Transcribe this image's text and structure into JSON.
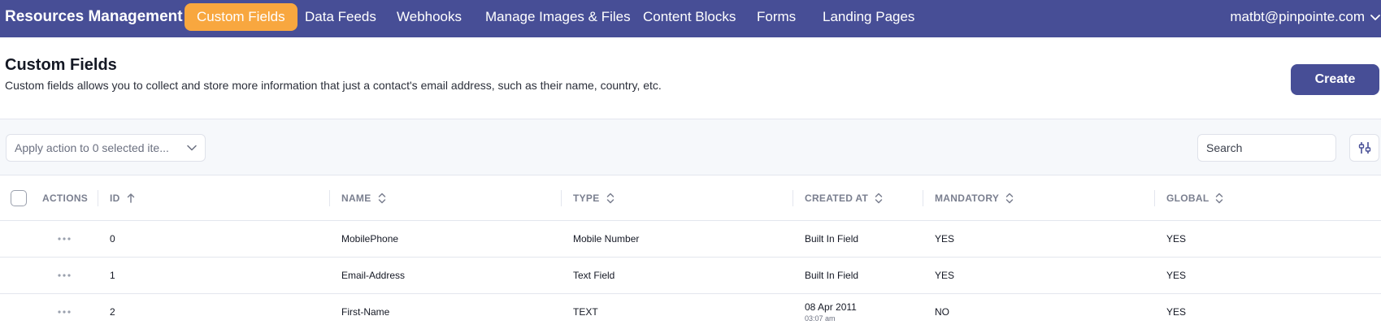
{
  "nav": {
    "brand": "Resources Management",
    "items": [
      {
        "label": "Custom Fields",
        "active": true
      },
      {
        "label": "Data Feeds",
        "active": false
      },
      {
        "label": "Webhooks",
        "active": false
      },
      {
        "label": "Manage Images & Files",
        "active": false
      },
      {
        "label": "Content Blocks",
        "active": false
      },
      {
        "label": "Forms",
        "active": false
      },
      {
        "label": "Landing Pages",
        "active": false
      }
    ],
    "user_email": "matbt@pinpointe.com",
    "user_menu_icon": "chevron-down-icon"
  },
  "header": {
    "title": "Custom Fields",
    "description": "Custom fields allows you to collect and store more information that just a contact's email address, such as their name, country, etc.",
    "create_label": "Create"
  },
  "toolbar": {
    "bulk_action_label": "Apply action to 0 selected ite...",
    "search_placeholder": "Search",
    "filter_icon": "filter-sliders-icon"
  },
  "table": {
    "columns": [
      {
        "label": "ACTIONS",
        "sortable": false
      },
      {
        "label": "ID",
        "sortable": true,
        "sort": "asc"
      },
      {
        "label": "NAME",
        "sortable": true,
        "sort": "none"
      },
      {
        "label": "TYPE",
        "sortable": true,
        "sort": "none"
      },
      {
        "label": "CREATED AT",
        "sortable": true,
        "sort": "none"
      },
      {
        "label": "MANDATORY",
        "sortable": true,
        "sort": "none"
      },
      {
        "label": "GLOBAL",
        "sortable": true,
        "sort": "none"
      }
    ],
    "rows": [
      {
        "id": "0",
        "name": "MobilePhone",
        "type": "Mobile Number",
        "created": "Built In Field",
        "created_time": "",
        "mandatory": "YES",
        "global": "YES"
      },
      {
        "id": "1",
        "name": "Email-Address",
        "type": "Text Field",
        "created": "Built In Field",
        "created_time": "",
        "mandatory": "YES",
        "global": "YES"
      },
      {
        "id": "2",
        "name": "First-Name",
        "type": "TEXT",
        "created": "08 Apr 2011",
        "created_time": "03:07 am",
        "mandatory": "NO",
        "global": "YES"
      }
    ]
  },
  "colors": {
    "nav_bg": "#474e96",
    "active_tab": "#f8a73f",
    "primary_button": "#474e96"
  }
}
